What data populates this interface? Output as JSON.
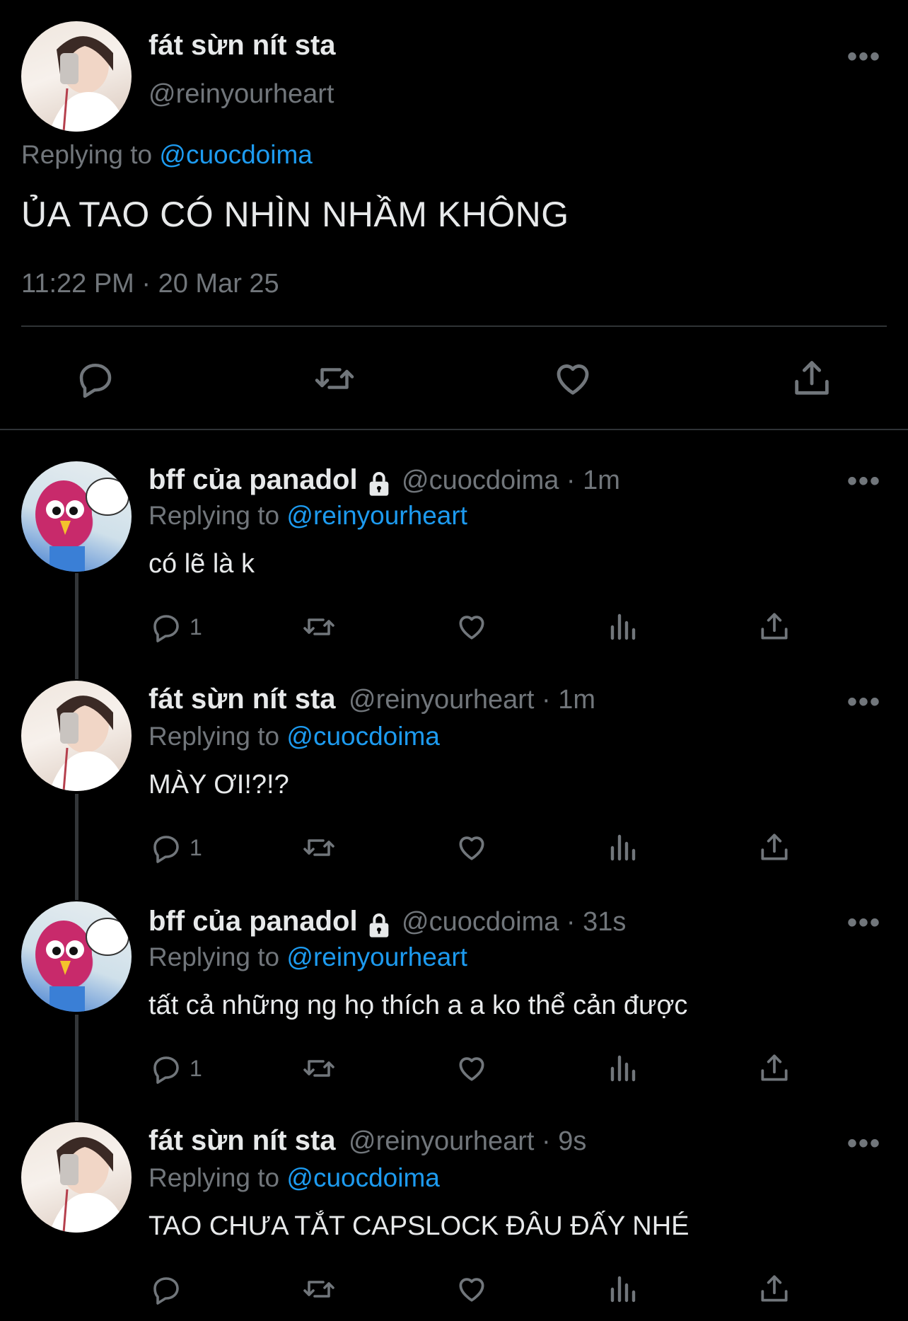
{
  "main_tweet": {
    "name": "fát sừn nít sta",
    "handle": "@reinyourheart",
    "replying_prefix": "Replying to ",
    "replying_to": "@cuocdoima",
    "text": "ỦA TAO CÓ NHÌN NHẦM KHÔNG",
    "timestamp": "11:22 PM · 20 Mar 25"
  },
  "replies": [
    {
      "name": "bff của panadol",
      "locked": true,
      "meta": "@cuocdoima · 1m",
      "replying_prefix": "Replying to ",
      "replying_to": "@reinyourheart",
      "text": "có lẽ là k",
      "reply_count": "1"
    },
    {
      "name": "fát sừn nít sta",
      "locked": false,
      "meta": "@reinyourheart · 1m",
      "replying_prefix": "Replying to ",
      "replying_to": "@cuocdoima",
      "text": "MÀY ƠI!?!?",
      "reply_count": "1"
    },
    {
      "name": "bff của panadol",
      "locked": true,
      "meta": "@cuocdoima · 31s",
      "replying_prefix": "Replying to ",
      "replying_to": "@reinyourheart",
      "text": "tất cả những ng họ thích a a ko thể cản được",
      "reply_count": "1"
    },
    {
      "name": "fát sừn nít sta",
      "locked": false,
      "meta": "@reinyourheart · 9s",
      "replying_prefix": "Replying to ",
      "replying_to": "@cuocdoima",
      "text": "TAO CHƯA TẮT CAPSLOCK ĐÂU ĐẤY NHÉ",
      "reply_count": ""
    }
  ],
  "more_label": "•••",
  "colors": {
    "background": "#000000",
    "text": "#e7e9ea",
    "muted": "#71767b",
    "accent": "#1d9bf0",
    "divider": "#2f3336"
  },
  "icons": [
    "reply-icon",
    "retweet-icon",
    "like-icon",
    "views-icon",
    "share-icon",
    "lock-icon",
    "more-icon"
  ]
}
